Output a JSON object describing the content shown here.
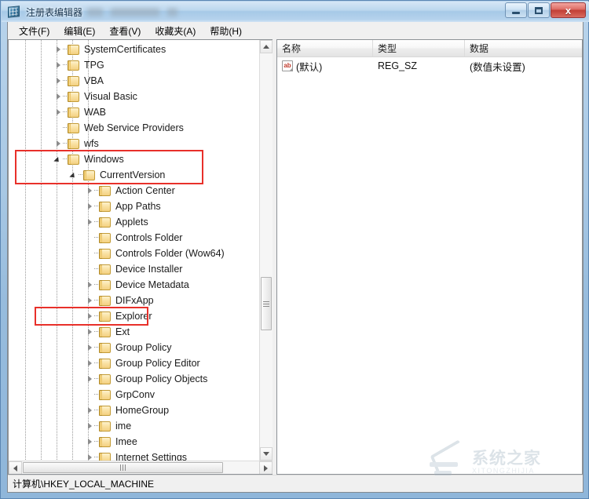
{
  "window": {
    "title": "注册表编辑器",
    "app_icon": "registry-editor-icon",
    "buttons": {
      "minimize": "最小化",
      "maximize": "最大化",
      "close": "关闭"
    }
  },
  "menubar": {
    "items": [
      {
        "label": "文件(F)",
        "name": "menu-file"
      },
      {
        "label": "编辑(E)",
        "name": "menu-edit"
      },
      {
        "label": "查看(V)",
        "name": "menu-view"
      },
      {
        "label": "收藏夹(A)",
        "name": "menu-favorites"
      },
      {
        "label": "帮助(H)",
        "name": "menu-help"
      }
    ]
  },
  "tree": {
    "nodes": [
      {
        "label": "SystemCertificates",
        "depth": 3,
        "state": "collapsed",
        "highlight": "none"
      },
      {
        "label": "TPG",
        "depth": 3,
        "state": "collapsed",
        "highlight": "none"
      },
      {
        "label": "VBA",
        "depth": 3,
        "state": "collapsed",
        "highlight": "none"
      },
      {
        "label": "Visual Basic",
        "depth": 3,
        "state": "collapsed",
        "highlight": "none"
      },
      {
        "label": "WAB",
        "depth": 3,
        "state": "collapsed",
        "highlight": "none"
      },
      {
        "label": "Web Service Providers",
        "depth": 3,
        "state": "leaf",
        "highlight": "none"
      },
      {
        "label": "wfs",
        "depth": 3,
        "state": "collapsed",
        "highlight": "none"
      },
      {
        "label": "Windows",
        "depth": 3,
        "state": "expanded",
        "highlight": "box-top"
      },
      {
        "label": "CurrentVersion",
        "depth": 4,
        "state": "expanded",
        "highlight": "box-bottom"
      },
      {
        "label": "Action Center",
        "depth": 5,
        "state": "collapsed",
        "highlight": "none"
      },
      {
        "label": "App Paths",
        "depth": 5,
        "state": "collapsed",
        "highlight": "none"
      },
      {
        "label": "Applets",
        "depth": 5,
        "state": "collapsed",
        "highlight": "none"
      },
      {
        "label": "Controls Folder",
        "depth": 5,
        "state": "leaf",
        "highlight": "none"
      },
      {
        "label": "Controls Folder (Wow64)",
        "depth": 5,
        "state": "leaf",
        "highlight": "none"
      },
      {
        "label": "Device Installer",
        "depth": 5,
        "state": "leaf",
        "highlight": "none"
      },
      {
        "label": "Device Metadata",
        "depth": 5,
        "state": "collapsed",
        "highlight": "none"
      },
      {
        "label": "DIFxApp",
        "depth": 5,
        "state": "collapsed",
        "highlight": "none"
      },
      {
        "label": "Explorer",
        "depth": 5,
        "state": "collapsed",
        "highlight": "box-single"
      },
      {
        "label": "Ext",
        "depth": 5,
        "state": "collapsed",
        "highlight": "none"
      },
      {
        "label": "Group Policy",
        "depth": 5,
        "state": "collapsed",
        "highlight": "none"
      },
      {
        "label": "Group Policy Editor",
        "depth": 5,
        "state": "collapsed",
        "highlight": "none"
      },
      {
        "label": "Group Policy Objects",
        "depth": 5,
        "state": "collapsed",
        "highlight": "none"
      },
      {
        "label": "GrpConv",
        "depth": 5,
        "state": "leaf",
        "highlight": "none"
      },
      {
        "label": "HomeGroup",
        "depth": 5,
        "state": "collapsed",
        "highlight": "none"
      },
      {
        "label": "ime",
        "depth": 5,
        "state": "collapsed",
        "highlight": "none"
      },
      {
        "label": "Imee",
        "depth": 5,
        "state": "collapsed",
        "highlight": "none"
      },
      {
        "label": "Internet Settings",
        "depth": 5,
        "state": "collapsed",
        "highlight": "none"
      }
    ]
  },
  "list": {
    "columns": [
      {
        "label": "名称",
        "name": "column-name"
      },
      {
        "label": "类型",
        "name": "column-type"
      },
      {
        "label": "数据",
        "name": "column-data"
      }
    ],
    "rows": [
      {
        "icon": "string-value-icon",
        "name": "(默认)",
        "type": "REG_SZ",
        "data": "(数值未设置)"
      }
    ]
  },
  "statusbar": {
    "path": "计算机\\HKEY_LOCAL_MACHINE"
  },
  "watermark": {
    "cn": "系统之家",
    "en": "XITONGZHIJIA",
    "logo": "house-logo-icon"
  },
  "colors": {
    "annotation_red": "#e8302a",
    "titlebar_blue": "#a6c9e7",
    "close_red": "#c23f36",
    "key_icon_yellow": "#f3d082"
  }
}
